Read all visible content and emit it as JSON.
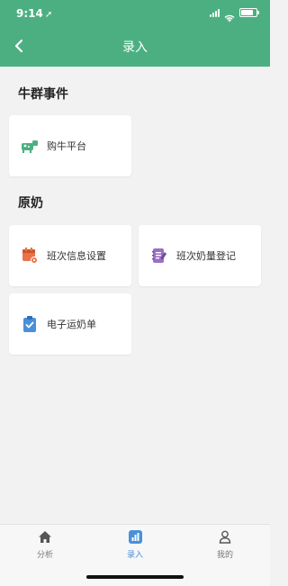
{
  "status": {
    "time": "9:14",
    "location_arrow": "➚"
  },
  "nav": {
    "title": "录入",
    "back_icon": "chevron-left-icon"
  },
  "sections": [
    {
      "title": "牛群事件",
      "items": [
        {
          "label": "购牛平台",
          "icon": "cow-icon",
          "color": "#4caf82"
        }
      ]
    },
    {
      "title": "原奶",
      "items": [
        {
          "label": "班次信息设置",
          "icon": "calendar-settings-icon",
          "color": "#e8734a"
        },
        {
          "label": "班次奶量登记",
          "icon": "notebook-pen-icon",
          "color": "#9b6fc3"
        },
        {
          "label": "电子运奶单",
          "icon": "clipboard-check-icon",
          "color": "#4a90d9"
        }
      ]
    }
  ],
  "tabs": [
    {
      "label": "分析",
      "icon": "home-icon",
      "active": false
    },
    {
      "label": "录入",
      "icon": "chart-icon",
      "active": true
    },
    {
      "label": "我的",
      "icon": "user-icon",
      "active": false
    }
  ],
  "colors": {
    "primary": "#4caf82",
    "tab_active": "#4a90d9"
  }
}
